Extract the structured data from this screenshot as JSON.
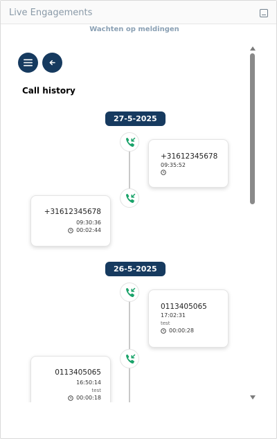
{
  "window": {
    "title": "Live Engagements"
  },
  "status": {
    "text": "Wachten op meldingen"
  },
  "content": {
    "heading": "Call history"
  },
  "icons": {
    "menu": "menu-icon",
    "back": "arrow-left-icon",
    "call": "incoming-call-icon",
    "clock": "clock-icon"
  },
  "colors": {
    "navy": "#163a5f",
    "call_green": "#1aa36a"
  },
  "history": [
    {
      "date": "27-5-2025",
      "calls": [
        {
          "number": "+31612345678",
          "time": "09:35:52",
          "note": "",
          "duration": ""
        },
        {
          "number": "+31612345678",
          "time": "09:30:36",
          "note": "",
          "duration": "00:02:44"
        }
      ]
    },
    {
      "date": "26-5-2025",
      "calls": [
        {
          "number": "0113405065",
          "time": "17:02:31",
          "note": "test",
          "duration": "00:00:28"
        },
        {
          "number": "0113405065",
          "time": "16:50:14",
          "note": "test",
          "duration": "00:00:18"
        }
      ]
    }
  ]
}
